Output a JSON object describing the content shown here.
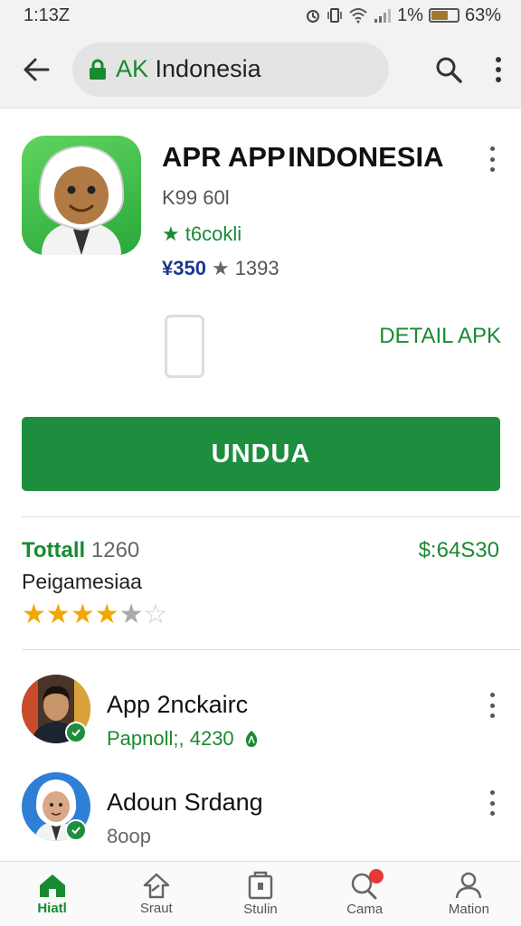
{
  "status": {
    "time": "1:13Z",
    "battery_text": "1%",
    "battery_level": "63%",
    "battery_fill": 0.63
  },
  "toolbar": {
    "url_prefix": "AK",
    "url_text": " Indonesia"
  },
  "app": {
    "title": "APR APP INDONESIA",
    "size": "K99 60l",
    "developer": "t6cokli",
    "rating_highlight": "¥350",
    "rating_count": "1393"
  },
  "detail_link": "DETAIL APK",
  "install_label": "UNDUA",
  "stats": {
    "label": "Tottall",
    "count": "1260",
    "price": "$:64S30",
    "subtitle": "Peigamesiaa",
    "rating": 4
  },
  "reviews": [
    {
      "name": "App 2nckairc",
      "meta": "Papnoll;, 4230"
    },
    {
      "name": "Adoun Srdang",
      "meta": "8oop"
    }
  ],
  "nav": [
    {
      "label": "Hiatl",
      "icon": "home-icon",
      "active": true
    },
    {
      "label": "Sraut",
      "icon": "games-icon"
    },
    {
      "label": "Stulin",
      "icon": "apps-icon"
    },
    {
      "label": "Cama",
      "icon": "search-icon"
    },
    {
      "label": "Mation",
      "icon": "account-icon"
    }
  ],
  "colors": {
    "accent": "#1e8e3e",
    "star": "#f2a600",
    "toolbar": "#f2f2f2"
  }
}
